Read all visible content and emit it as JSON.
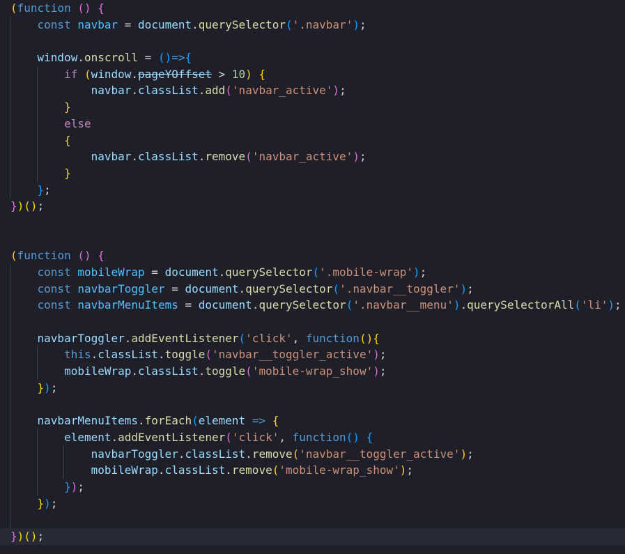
{
  "editor": {
    "language": "javascript",
    "current_line": 33,
    "theme": {
      "background": "#1e1f29",
      "current_line_background": "#282a36",
      "indent_guide": "#3d3f4d",
      "token_colors": {
        "paren1": "#ffd700",
        "paren2": "#da70d6",
        "paren3": "#179fff",
        "kw": "#569cd6",
        "ctrl": "#c586c0",
        "var": "#9cdcfe",
        "obj": "#4fc1ff",
        "fn": "#dcdcaa",
        "str": "#ce9178",
        "num": "#b5cea8",
        "op": "#d4d4d4"
      }
    },
    "lines": [
      {
        "tokens": [
          [
            "paren1",
            "("
          ],
          [
            "kw",
            "function"
          ],
          [
            "op",
            " "
          ],
          [
            "paren2",
            "()"
          ],
          [
            "op",
            " "
          ],
          [
            "paren2",
            "{"
          ]
        ]
      },
      {
        "tokens": [
          [
            "op",
            "    "
          ],
          [
            "kw",
            "const"
          ],
          [
            "op",
            " "
          ],
          [
            "obj",
            "navbar"
          ],
          [
            "op",
            " = "
          ],
          [
            "var",
            "document"
          ],
          [
            "op",
            "."
          ],
          [
            "fn",
            "querySelector"
          ],
          [
            "paren3",
            "("
          ],
          [
            "str",
            "'.navbar'"
          ],
          [
            "paren3",
            ")"
          ],
          [
            "op",
            ";"
          ]
        ]
      },
      {
        "tokens": []
      },
      {
        "tokens": [
          [
            "op",
            "    "
          ],
          [
            "var",
            "window"
          ],
          [
            "op",
            "."
          ],
          [
            "fn",
            "onscroll"
          ],
          [
            "op",
            " = "
          ],
          [
            "paren3",
            "()"
          ],
          [
            "kw",
            "=>"
          ],
          [
            "paren3",
            "{"
          ]
        ]
      },
      {
        "tokens": [
          [
            "op",
            "        "
          ],
          [
            "ctrl",
            "if"
          ],
          [
            "op",
            " "
          ],
          [
            "paren1",
            "("
          ],
          [
            "var",
            "window"
          ],
          [
            "op",
            "."
          ],
          [
            "dep",
            "pageYOffset"
          ],
          [
            "op",
            " > "
          ],
          [
            "num",
            "10"
          ],
          [
            "paren1",
            ")"
          ],
          [
            "op",
            " "
          ],
          [
            "paren1",
            "{"
          ]
        ]
      },
      {
        "tokens": [
          [
            "op",
            "            "
          ],
          [
            "var",
            "navbar"
          ],
          [
            "op",
            "."
          ],
          [
            "var",
            "classList"
          ],
          [
            "op",
            "."
          ],
          [
            "fn",
            "add"
          ],
          [
            "paren2",
            "("
          ],
          [
            "str",
            "'navbar_active'"
          ],
          [
            "paren2",
            ")"
          ],
          [
            "op",
            ";"
          ]
        ]
      },
      {
        "tokens": [
          [
            "op",
            "        "
          ],
          [
            "paren1",
            "}"
          ]
        ]
      },
      {
        "tokens": [
          [
            "op",
            "        "
          ],
          [
            "ctrl",
            "else"
          ]
        ]
      },
      {
        "tokens": [
          [
            "op",
            "        "
          ],
          [
            "paren1",
            "{"
          ]
        ]
      },
      {
        "tokens": [
          [
            "op",
            "            "
          ],
          [
            "var",
            "navbar"
          ],
          [
            "op",
            "."
          ],
          [
            "var",
            "classList"
          ],
          [
            "op",
            "."
          ],
          [
            "fn",
            "remove"
          ],
          [
            "paren2",
            "("
          ],
          [
            "str",
            "'navbar_active'"
          ],
          [
            "paren2",
            ")"
          ],
          [
            "op",
            ";"
          ]
        ]
      },
      {
        "tokens": [
          [
            "op",
            "        "
          ],
          [
            "paren1",
            "}"
          ]
        ]
      },
      {
        "tokens": [
          [
            "op",
            "    "
          ],
          [
            "paren3",
            "}"
          ],
          [
            "op",
            ";"
          ]
        ]
      },
      {
        "tokens": [
          [
            "paren2",
            "}"
          ],
          [
            "paren1",
            ")"
          ],
          [
            "paren1",
            "()"
          ],
          [
            "op",
            ";"
          ]
        ]
      },
      {
        "tokens": []
      },
      {
        "tokens": []
      },
      {
        "tokens": [
          [
            "paren1",
            "("
          ],
          [
            "kw",
            "function"
          ],
          [
            "op",
            " "
          ],
          [
            "paren2",
            "()"
          ],
          [
            "op",
            " "
          ],
          [
            "paren2",
            "{"
          ]
        ]
      },
      {
        "tokens": [
          [
            "op",
            "    "
          ],
          [
            "kw",
            "const"
          ],
          [
            "op",
            " "
          ],
          [
            "obj",
            "mobileWrap"
          ],
          [
            "op",
            " = "
          ],
          [
            "var",
            "document"
          ],
          [
            "op",
            "."
          ],
          [
            "fn",
            "querySelector"
          ],
          [
            "paren3",
            "("
          ],
          [
            "str",
            "'.mobile-wrap'"
          ],
          [
            "paren3",
            ")"
          ],
          [
            "op",
            ";"
          ]
        ]
      },
      {
        "tokens": [
          [
            "op",
            "    "
          ],
          [
            "kw",
            "const"
          ],
          [
            "op",
            " "
          ],
          [
            "obj",
            "navbarToggler"
          ],
          [
            "op",
            " = "
          ],
          [
            "var",
            "document"
          ],
          [
            "op",
            "."
          ],
          [
            "fn",
            "querySelector"
          ],
          [
            "paren3",
            "("
          ],
          [
            "str",
            "'.navbar__toggler'"
          ],
          [
            "paren3",
            ")"
          ],
          [
            "op",
            ";"
          ]
        ]
      },
      {
        "tokens": [
          [
            "op",
            "    "
          ],
          [
            "kw",
            "const"
          ],
          [
            "op",
            " "
          ],
          [
            "obj",
            "navbarMenuItems"
          ],
          [
            "op",
            " = "
          ],
          [
            "var",
            "document"
          ],
          [
            "op",
            "."
          ],
          [
            "fn",
            "querySelector"
          ],
          [
            "paren3",
            "("
          ],
          [
            "str",
            "'.navbar__menu'"
          ],
          [
            "paren3",
            ")"
          ],
          [
            "op",
            "."
          ],
          [
            "fn",
            "querySelectorAll"
          ],
          [
            "paren3",
            "("
          ],
          [
            "str",
            "'li'"
          ],
          [
            "paren3",
            ")"
          ],
          [
            "op",
            ";"
          ]
        ]
      },
      {
        "tokens": []
      },
      {
        "tokens": [
          [
            "op",
            "    "
          ],
          [
            "var",
            "navbarToggler"
          ],
          [
            "op",
            "."
          ],
          [
            "fn",
            "addEventListener"
          ],
          [
            "paren3",
            "("
          ],
          [
            "str",
            "'click'"
          ],
          [
            "op",
            ", "
          ],
          [
            "kw",
            "function"
          ],
          [
            "paren1",
            "()"
          ],
          [
            "paren1",
            "{"
          ]
        ]
      },
      {
        "tokens": [
          [
            "op",
            "        "
          ],
          [
            "kw",
            "this"
          ],
          [
            "op",
            "."
          ],
          [
            "var",
            "classList"
          ],
          [
            "op",
            "."
          ],
          [
            "fn",
            "toggle"
          ],
          [
            "paren2",
            "("
          ],
          [
            "str",
            "'navbar__toggler_active'"
          ],
          [
            "paren2",
            ")"
          ],
          [
            "op",
            ";"
          ]
        ]
      },
      {
        "tokens": [
          [
            "op",
            "        "
          ],
          [
            "var",
            "mobileWrap"
          ],
          [
            "op",
            "."
          ],
          [
            "var",
            "classList"
          ],
          [
            "op",
            "."
          ],
          [
            "fn",
            "toggle"
          ],
          [
            "paren2",
            "("
          ],
          [
            "str",
            "'mobile-wrap_show'"
          ],
          [
            "paren2",
            ")"
          ],
          [
            "op",
            ";"
          ]
        ]
      },
      {
        "tokens": [
          [
            "op",
            "    "
          ],
          [
            "paren1",
            "}"
          ],
          [
            "paren3",
            ")"
          ],
          [
            "op",
            ";"
          ]
        ]
      },
      {
        "tokens": []
      },
      {
        "tokens": [
          [
            "op",
            "    "
          ],
          [
            "var",
            "navbarMenuItems"
          ],
          [
            "op",
            "."
          ],
          [
            "fn",
            "forEach"
          ],
          [
            "paren3",
            "("
          ],
          [
            "var",
            "element"
          ],
          [
            "op",
            " "
          ],
          [
            "kw",
            "=>"
          ],
          [
            "op",
            " "
          ],
          [
            "paren1",
            "{"
          ]
        ]
      },
      {
        "tokens": [
          [
            "op",
            "        "
          ],
          [
            "var",
            "element"
          ],
          [
            "op",
            "."
          ],
          [
            "fn",
            "addEventListener"
          ],
          [
            "paren2",
            "("
          ],
          [
            "str",
            "'click'"
          ],
          [
            "op",
            ", "
          ],
          [
            "kw",
            "function"
          ],
          [
            "paren3",
            "()"
          ],
          [
            "op",
            " "
          ],
          [
            "paren3",
            "{"
          ]
        ]
      },
      {
        "tokens": [
          [
            "op",
            "            "
          ],
          [
            "var",
            "navbarToggler"
          ],
          [
            "op",
            "."
          ],
          [
            "var",
            "classList"
          ],
          [
            "op",
            "."
          ],
          [
            "fn",
            "remove"
          ],
          [
            "paren1",
            "("
          ],
          [
            "str",
            "'navbar__toggler_active'"
          ],
          [
            "paren1",
            ")"
          ],
          [
            "op",
            ";"
          ]
        ]
      },
      {
        "tokens": [
          [
            "op",
            "            "
          ],
          [
            "var",
            "mobileWrap"
          ],
          [
            "op",
            "."
          ],
          [
            "var",
            "classList"
          ],
          [
            "op",
            "."
          ],
          [
            "fn",
            "remove"
          ],
          [
            "paren1",
            "("
          ],
          [
            "str",
            "'mobile-wrap_show'"
          ],
          [
            "paren1",
            ")"
          ],
          [
            "op",
            ";"
          ]
        ]
      },
      {
        "tokens": [
          [
            "op",
            "        "
          ],
          [
            "paren3",
            "}"
          ],
          [
            "paren2",
            ")"
          ],
          [
            "op",
            ";"
          ]
        ]
      },
      {
        "tokens": [
          [
            "op",
            "    "
          ],
          [
            "paren1",
            "}"
          ],
          [
            "paren3",
            ")"
          ],
          [
            "op",
            ";"
          ]
        ]
      },
      {
        "tokens": []
      },
      {
        "tokens": [
          [
            "paren2",
            "}"
          ],
          [
            "paren1",
            ")"
          ],
          [
            "paren1",
            "()"
          ],
          [
            "op",
            ";"
          ]
        ]
      }
    ]
  }
}
